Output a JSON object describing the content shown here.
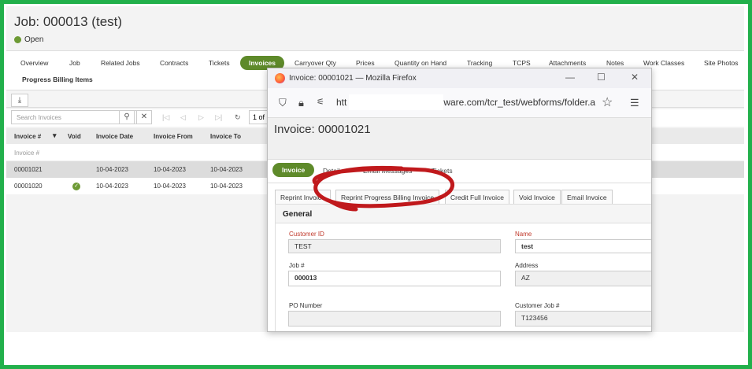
{
  "job": {
    "title": "Job: 000013 (test)",
    "status": "Open"
  },
  "tabs": [
    {
      "label": "Overview"
    },
    {
      "label": "Job"
    },
    {
      "label": "Related Jobs"
    },
    {
      "label": "Contracts"
    },
    {
      "label": "Tickets"
    },
    {
      "label": "Invoices"
    },
    {
      "label": "Carryover Qty"
    },
    {
      "label": "Prices"
    },
    {
      "label": "Quantity on Hand"
    },
    {
      "label": "Tracking"
    },
    {
      "label": "TCPS"
    },
    {
      "label": "Attachments"
    },
    {
      "label": "Notes"
    },
    {
      "label": "Work Classes"
    },
    {
      "label": "Site Photos"
    },
    {
      "label": "Progress Billing Items"
    }
  ],
  "toolbar": {
    "search_placeholder": "Search Invoices",
    "page_value": "1 of"
  },
  "grid": {
    "columns": [
      "Invoice #",
      "Void",
      "Invoice Date",
      "Invoice From",
      "Invoice To"
    ],
    "filter_placeholder": "Invoice #",
    "rows": [
      {
        "invoice": "00001021",
        "void": false,
        "date": "10-04-2023",
        "from": "10-04-2023",
        "to": "10-04-2023"
      },
      {
        "invoice": "00001020",
        "void": true,
        "date": "10-04-2023",
        "from": "10-04-2023",
        "to": "10-04-2023"
      }
    ]
  },
  "popup": {
    "window_title": "Invoice: 00001021 — Mozilla Firefox",
    "url_start": "htt",
    "url_end": "ware.com/tcr_test/webforms/folder.a",
    "heading": "Invoice: 00001021",
    "tabs": [
      "Invoice",
      "Details",
      "Email Messages",
      "Tickets"
    ],
    "actions": [
      "Reprint Invoice",
      "Reprint Progress Billing Invoice",
      "Credit Full Invoice",
      "Void Invoice",
      "Email Invoice"
    ],
    "section_title": "General",
    "fields": {
      "customer_id_label": "Customer ID",
      "customer_id": "TEST",
      "name_label": "Name",
      "name": "test",
      "job_label": "Job #",
      "job": "000013",
      "address_label": "Address",
      "address": "AZ",
      "po_label": "PO Number",
      "po": "",
      "customer_job_label": "Customer Job #",
      "customer_job": "T123456"
    }
  },
  "colors": {
    "accent": "#5e8a2a",
    "frame": "#22b04b",
    "annotation": "#c0191c"
  },
  "icons": [
    "download-icon",
    "search-icon",
    "close-icon",
    "first-page-icon",
    "prev-page-icon",
    "next-page-icon",
    "last-page-icon",
    "refresh-icon",
    "shield-icon",
    "lock-icon",
    "permissions-icon",
    "star-icon",
    "menu-icon",
    "check-icon"
  ]
}
